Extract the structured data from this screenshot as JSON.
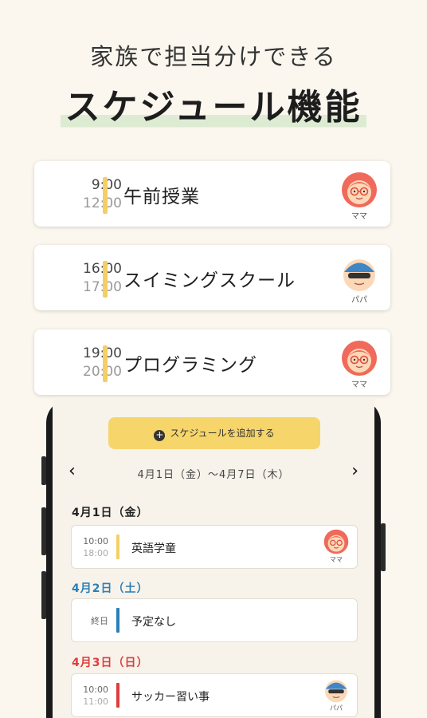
{
  "header": {
    "subtitle": "家族で担当分けできる",
    "title": "スケジュール機能"
  },
  "colors": {
    "background": "#FBF7EE",
    "accent_yellow": "#F4CF62",
    "highlight_green": "#DDEBD3",
    "saturday_blue": "#2B7FB8",
    "sunday_red": "#E03C3C"
  },
  "cards": [
    {
      "start": "9:00",
      "end": "12:00",
      "label": "午前授業",
      "avatar": "mama-avatar-icon",
      "role": "ママ"
    },
    {
      "start": "16:00",
      "end": "17:00",
      "label": "スイミングスクール",
      "avatar": "papa-avatar-icon",
      "role": "パパ"
    },
    {
      "start": "19:00",
      "end": "20:00",
      "label": "プログラミング",
      "avatar": "mama-avatar-icon",
      "role": "ママ"
    }
  ],
  "phone": {
    "add_button": "スケジュールを追加する",
    "add_icon": "plus-circle-icon",
    "prev_icon": "chevron-left-icon",
    "next_icon": "chevron-right-icon",
    "range": "4月1日（金）〜4月7日（木）",
    "days": [
      {
        "heading": "4月1日（金）",
        "color": "#222222",
        "event": {
          "start": "10:00",
          "end": "18:00",
          "label": "英語学童",
          "bar_color": "#F4CF62",
          "avatar": "mama-avatar-icon",
          "role": "ママ"
        }
      },
      {
        "heading": "4月2日（土）",
        "color": "#2B7FB8",
        "event": {
          "allday": "終日",
          "label": "予定なし",
          "bar_color": "#2B7FB8"
        }
      },
      {
        "heading": "4月3日（日）",
        "color": "#E03C3C",
        "event": {
          "start": "10:00",
          "end": "11:00",
          "label": "サッカー習い事",
          "bar_color": "#E03C3C",
          "avatar": "papa-avatar-icon",
          "role": "パパ"
        }
      }
    ]
  }
}
